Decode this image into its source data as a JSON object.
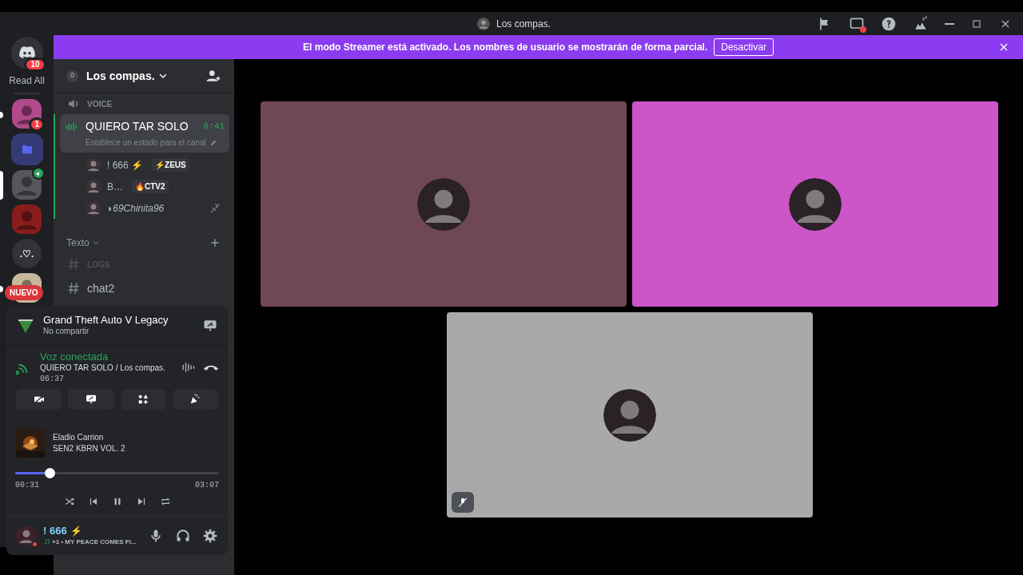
{
  "window": {
    "title": "Los compas."
  },
  "banner": {
    "text": "El modo Streamer está activado. Los nombres de usuario se mostrarán de forma parcial.",
    "button": "Desactivar"
  },
  "rail": {
    "home_badge": "10",
    "read_all": "Read All",
    "new_badge": "NUEVO",
    "servers": [
      {
        "kind": "avatar",
        "color": "#b04a8a",
        "badge": "1",
        "unread": true,
        "selected": false,
        "voice": false
      },
      {
        "kind": "folder",
        "color": "#5865f2",
        "unread": false,
        "selected": false,
        "voice": false
      },
      {
        "kind": "avatar",
        "color": "#55575c",
        "unread": false,
        "selected": true,
        "voice": true
      },
      {
        "kind": "avatar",
        "color": "#8a1c1c",
        "unread": false,
        "selected": false,
        "voice": false
      },
      {
        "kind": "text",
        "label": ".♡.",
        "unread": false,
        "selected": false,
        "voice": false
      },
      {
        "kind": "avatar",
        "color": "#c9b79a",
        "unread": true,
        "selected": false,
        "voice": false
      }
    ]
  },
  "server": {
    "count": "0",
    "name": "Los compas."
  },
  "voice_category": {
    "label": "VOICE"
  },
  "voice_channel": {
    "name": "QUIERO TAR SOLO",
    "time": "6:41",
    "status": "Establece un estado para el canal",
    "members": [
      {
        "name": "! 666 ⚡",
        "tag": "⚡ZEUS",
        "muted": false
      },
      {
        "name": "B…",
        "tag": "🔥CTV2",
        "muted": false
      },
      {
        "name": "◗69Chinita96",
        "muted": true
      }
    ]
  },
  "text_category": {
    "label": "Texto",
    "channels": [
      {
        "name": "LOGS",
        "muted": true
      },
      {
        "name": "chat2",
        "muted": false
      }
    ]
  },
  "activity": {
    "game": "Grand Theft Auto V Legacy",
    "subtitle": "No compartir"
  },
  "voice_status": {
    "title": "Voz conectada",
    "channel": "QUIERO TAR SOLO / Los compas.",
    "time": "06:37"
  },
  "music": {
    "artist": "Eladio Carrion",
    "album": "SEN2 KBRN VOL. 2",
    "level": 0.17,
    "elapsed": "00:31",
    "total": "03:07"
  },
  "user": {
    "name": "! 666",
    "emoji": "⚡",
    "status": "+1 • MY PEACE COMES FI..."
  },
  "tiles": [
    {
      "color": "#6f4853",
      "muted": false
    },
    {
      "color": "#cc55c8",
      "muted": false
    },
    {
      "color": "#a9a9a9",
      "muted": true
    }
  ]
}
